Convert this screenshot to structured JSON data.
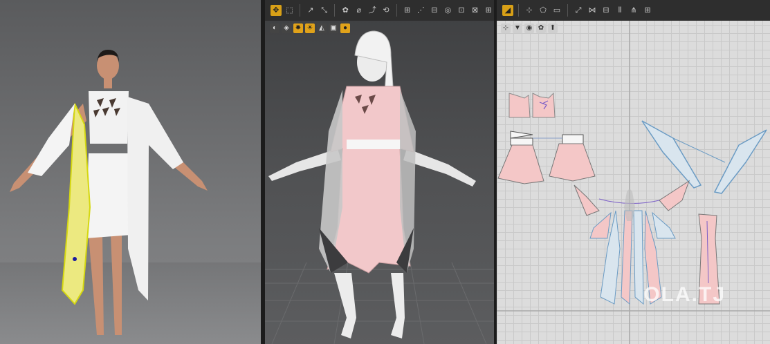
{
  "app": {
    "name": "3D garment design (CLO-style)"
  },
  "panels": {
    "left": {
      "name": "3D render preview"
    },
    "middle": {
      "name": "3D avatar window"
    },
    "right": {
      "name": "2D pattern window"
    }
  },
  "toolbar_3d": {
    "icons": [
      "select-move-icon",
      "transform-icon",
      "edit-point-icon",
      "edit-curve-icon",
      "tack-icon",
      "pin-icon",
      "fold-icon",
      "simulate-icon",
      "segment-sewing-icon",
      "free-sewing-icon",
      "check-sewing-icon",
      "pin-box-icon",
      "arrange-icon",
      "measure-icon",
      "tape-icon",
      "fit-icon"
    ]
  },
  "toolbar_2d": {
    "icons": [
      "select-pattern-icon",
      "edit-pattern-icon",
      "polygon-icon",
      "rectangle-icon",
      "internal-line-icon",
      "dart-icon",
      "seam-allowance-icon",
      "segment-sew-icon",
      "free-sew-icon",
      "trace-icon"
    ]
  },
  "subbar_3d": {
    "icons": [
      "view-avatar-icon",
      "fabric-view-icon",
      "texture-icon",
      "light-icon",
      "camera-icon",
      "render-icon",
      "settings-icon"
    ]
  },
  "subbar_2d": {
    "icons": [
      "grid-icon",
      "pattern-view-icon",
      "texture-icon",
      "lock-icon",
      "sewing-view-icon"
    ]
  },
  "colors": {
    "fabric_pink": "#f4c7c7",
    "selected_yellow": "#e8ec6a",
    "toolbar_active": "#d8a017"
  },
  "watermark": "OLA.TJ"
}
